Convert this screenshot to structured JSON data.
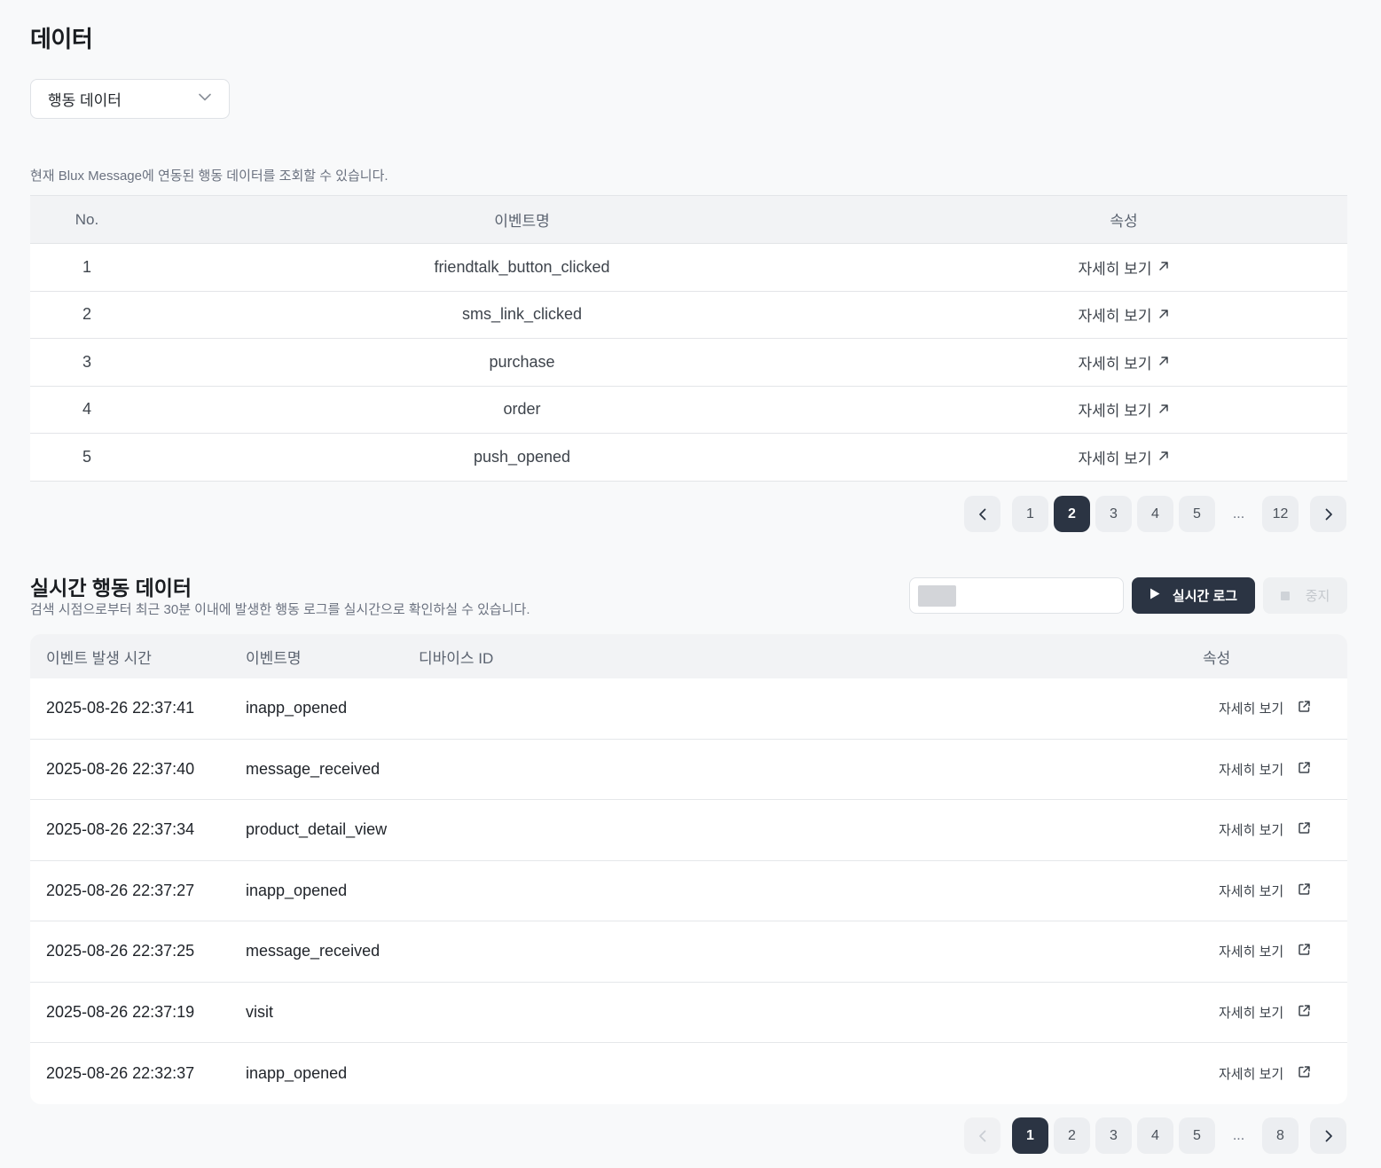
{
  "page": {
    "title": "데이터"
  },
  "dropdown": {
    "selected": "행동 데이터"
  },
  "event_table": {
    "description": "현재 Blux Message에 연동된 행동 데이터를 조회할 수 있습니다.",
    "headers": {
      "no": "No.",
      "event": "이벤트명",
      "attr": "속성"
    },
    "detail_label": "자세히 보기",
    "rows": [
      {
        "no": "1",
        "event": "friendtalk_button_clicked"
      },
      {
        "no": "2",
        "event": "sms_link_clicked"
      },
      {
        "no": "3",
        "event": "purchase"
      },
      {
        "no": "4",
        "event": "order"
      },
      {
        "no": "5",
        "event": "push_opened"
      }
    ],
    "pagination": {
      "pages": [
        "1",
        "2",
        "3",
        "4",
        "5"
      ],
      "ellipsis": "...",
      "last": "12",
      "current": "2"
    }
  },
  "realtime": {
    "title": "실시간 행동 데이터",
    "description": "검색 시점으로부터 최근 30분 이내에 발생한 행동 로그를 실시간으로 확인하실 수 있습니다.",
    "live_button": "실시간 로그",
    "stop_button": "중지",
    "headers": {
      "time": "이벤트 발생 시간",
      "event": "이벤트명",
      "device": "디바이스 ID",
      "attr": "속성"
    },
    "detail_label": "자세히 보기",
    "rows": [
      {
        "time": "2025-08-26 22:37:41",
        "event": "inapp_opened"
      },
      {
        "time": "2025-08-26 22:37:40",
        "event": "message_received"
      },
      {
        "time": "2025-08-26 22:37:34",
        "event": "product_detail_view"
      },
      {
        "time": "2025-08-26 22:37:27",
        "event": "inapp_opened"
      },
      {
        "time": "2025-08-26 22:37:25",
        "event": "message_received"
      },
      {
        "time": "2025-08-26 22:37:19",
        "event": "visit"
      },
      {
        "time": "2025-08-26 22:32:37",
        "event": "inapp_opened"
      }
    ],
    "pagination": {
      "pages": [
        "1",
        "2",
        "3",
        "4",
        "5"
      ],
      "ellipsis": "...",
      "last": "8",
      "current": "1"
    }
  },
  "icons": {
    "dropdown": "chevron-down-icon",
    "detail": "arrow-up-right-icon",
    "external": "external-link-icon",
    "prev": "chevron-left-icon",
    "next": "chevron-right-icon",
    "play": "play-icon",
    "stop": "stop-icon"
  },
  "colors": {
    "accent": "#2b3443",
    "background": "#f8f9fa"
  }
}
